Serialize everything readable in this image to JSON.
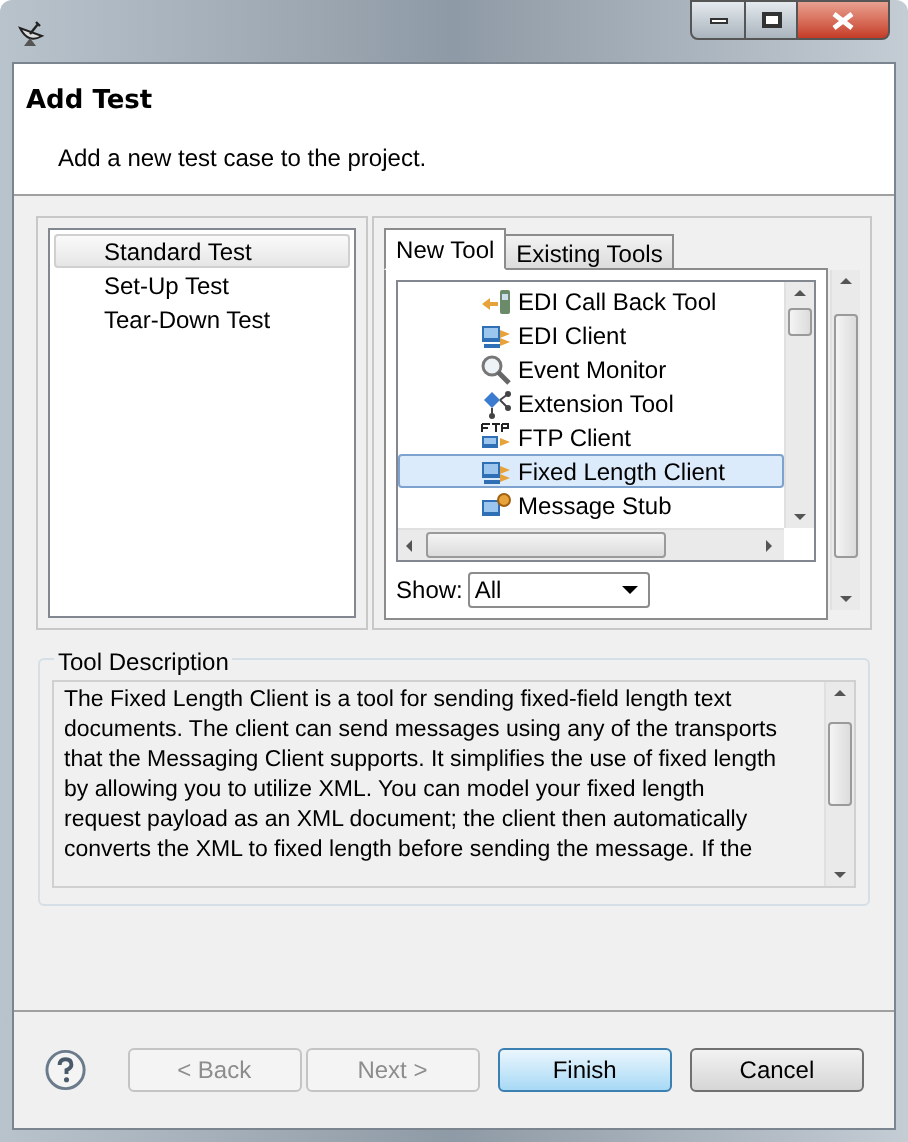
{
  "header": {
    "title": "Add Test",
    "subtitle": "Add a new test case to the project."
  },
  "test_types": [
    {
      "label": "Standard Test",
      "selected": true
    },
    {
      "label": "Set-Up Test",
      "selected": false
    },
    {
      "label": "Tear-Down Test",
      "selected": false
    }
  ],
  "tabs": [
    {
      "label": "New Tool",
      "selected": true
    },
    {
      "label": "Existing Tools",
      "selected": false
    }
  ],
  "tools": [
    {
      "label": "EDI Call Back Tool",
      "kind": "callback",
      "selected": false
    },
    {
      "label": "EDI Client",
      "kind": "client",
      "selected": false
    },
    {
      "label": "Event Monitor",
      "kind": "monitor",
      "selected": false
    },
    {
      "label": "Extension Tool",
      "kind": "extension",
      "selected": false
    },
    {
      "label": "FTP Client",
      "kind": "ftp",
      "selected": false
    },
    {
      "label": "Fixed Length Client",
      "kind": "client",
      "selected": true
    },
    {
      "label": "Message Stub",
      "kind": "stub",
      "selected": false
    }
  ],
  "show": {
    "label": "Show:",
    "value": "All"
  },
  "description": {
    "title": "Tool Description",
    "lines": [
      "The Fixed Length Client is a tool for sending fixed-field length text",
      "documents.  The client can send messages using any of the transports",
      "that the Messaging Client supports.  It simplifies the use of fixed length",
      "by allowing you to utilize XML.  You can model your fixed length",
      "request payload as an XML document; the client then automatically",
      "converts the XML to fixed length before sending the message.  If the"
    ]
  },
  "buttons": [
    {
      "label": "< Back",
      "disabled": true,
      "default": false
    },
    {
      "label": "Next >",
      "disabled": true,
      "default": false
    },
    {
      "label": "Finish",
      "disabled": false,
      "default": true
    },
    {
      "label": "Cancel",
      "disabled": false,
      "default": false
    }
  ]
}
